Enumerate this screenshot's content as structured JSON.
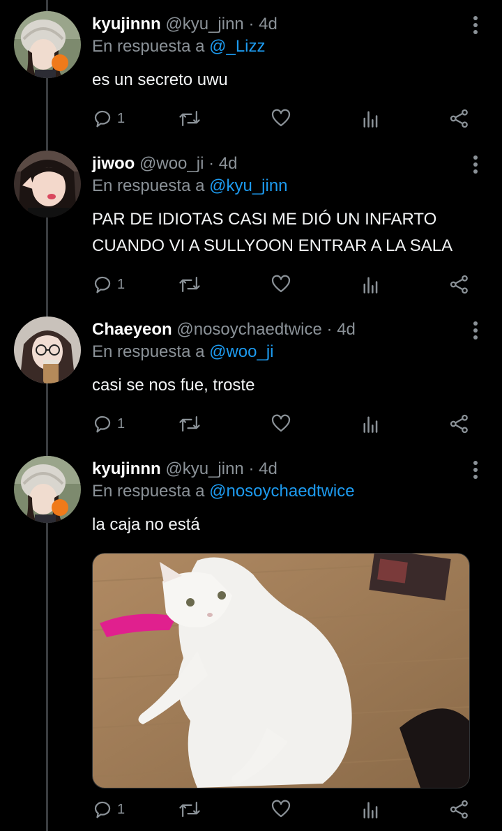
{
  "reply_prefix": "En respuesta a",
  "dot": "·",
  "tweets": [
    {
      "name": "kyujinnn",
      "handle": "@kyu_jinn",
      "time": "4d",
      "reply_to": "@_Lizz",
      "text_lines": [
        "es un secreto uwu"
      ],
      "reply_count": "1"
    },
    {
      "name": "jiwoo",
      "handle": "@woo_ji",
      "time": "4d",
      "reply_to": "@kyu_jinn",
      "text_lines": [
        "PAR DE IDIOTAS CASI ME DIÓ UN INFARTO",
        "CUANDO VI A SULLYOON ENTRAR A LA SALA"
      ],
      "reply_count": "1"
    },
    {
      "name": "Chaeyeon",
      "handle": "@nosoychaedtwice",
      "time": "4d",
      "reply_to": "@woo_ji",
      "text_lines": [
        "casi se nos fue, troste"
      ],
      "reply_count": "1"
    },
    {
      "name": "kyujinnn",
      "handle": "@kyu_jinn",
      "time": "4d",
      "reply_to": "@nosoychaedtwice",
      "text_lines": [
        "la caja no está"
      ],
      "reply_count": "1",
      "media": "white-cat-photo"
    }
  ],
  "icons": {
    "reply": "reply-icon",
    "retweet": "retweet-icon",
    "like": "heart-icon",
    "views": "views-icon",
    "share": "share-icon",
    "more": "more-options-icon"
  },
  "colors": {
    "background": "#000000",
    "text": "#f2f4f5",
    "muted": "#8b9298",
    "link": "#1d9bf0",
    "thread_line": "#3a3d40"
  }
}
